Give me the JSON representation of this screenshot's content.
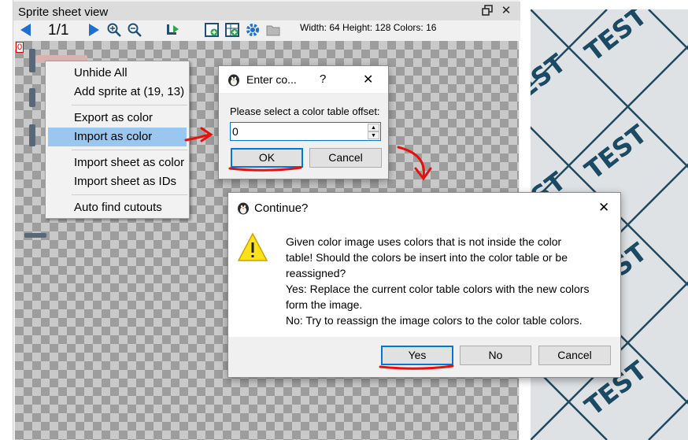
{
  "panel": {
    "title": "Sprite sheet view",
    "page_indicator": "1/1",
    "sprite_info": "Width: 64 Height: 128 Colors: 16",
    "sprite_index": "0",
    "toolbar_icons": [
      "prev-page-icon",
      "zoom-in-icon",
      "zoom-out-icon",
      "next-page-icon",
      "rotate-sprite-icon",
      "add-sprite-icon",
      "add-sheet-icon",
      "settings-gear-icon",
      "folder-icon"
    ]
  },
  "context_menu": {
    "items": [
      {
        "label": "Unhide All"
      },
      {
        "label": "Add sprite at (19, 13)"
      },
      {
        "label": "Export as color"
      },
      {
        "label": "Import as color"
      },
      {
        "label": "Import sheet as color"
      },
      {
        "label": "Import sheet as IDs"
      },
      {
        "label": "Auto find cutouts"
      }
    ],
    "highlighted_item": "Import as color"
  },
  "enter_dialog": {
    "title": "Enter co...",
    "help_glyph": "?",
    "close_glyph": "✕",
    "prompt": "Please select a color table offset:",
    "value": "0",
    "ok_label": "OK",
    "cancel_label": "Cancel"
  },
  "continue_dialog": {
    "title": "Continue?",
    "close_glyph": "✕",
    "message_lines": [
      "Given color image uses colors that is not inside the color",
      "table! Should the colors be insert into the color table or be",
      "reassigned?",
      "Yes: Replace the current color table colors with the new colors",
      "form the image.",
      "No: Try to reassign the image colors to the  color table colors."
    ],
    "yes_label": "Yes",
    "no_label": "No",
    "cancel_label": "Cancel"
  },
  "texture": {
    "label": "TEST",
    "line_color": "#1b4a64"
  },
  "colors": {
    "annotation_red": "#e8100c",
    "menu_highlight": "#9ac7ef",
    "default_button_border": "#0078d7",
    "warning_yellow": "#ffe11a"
  }
}
